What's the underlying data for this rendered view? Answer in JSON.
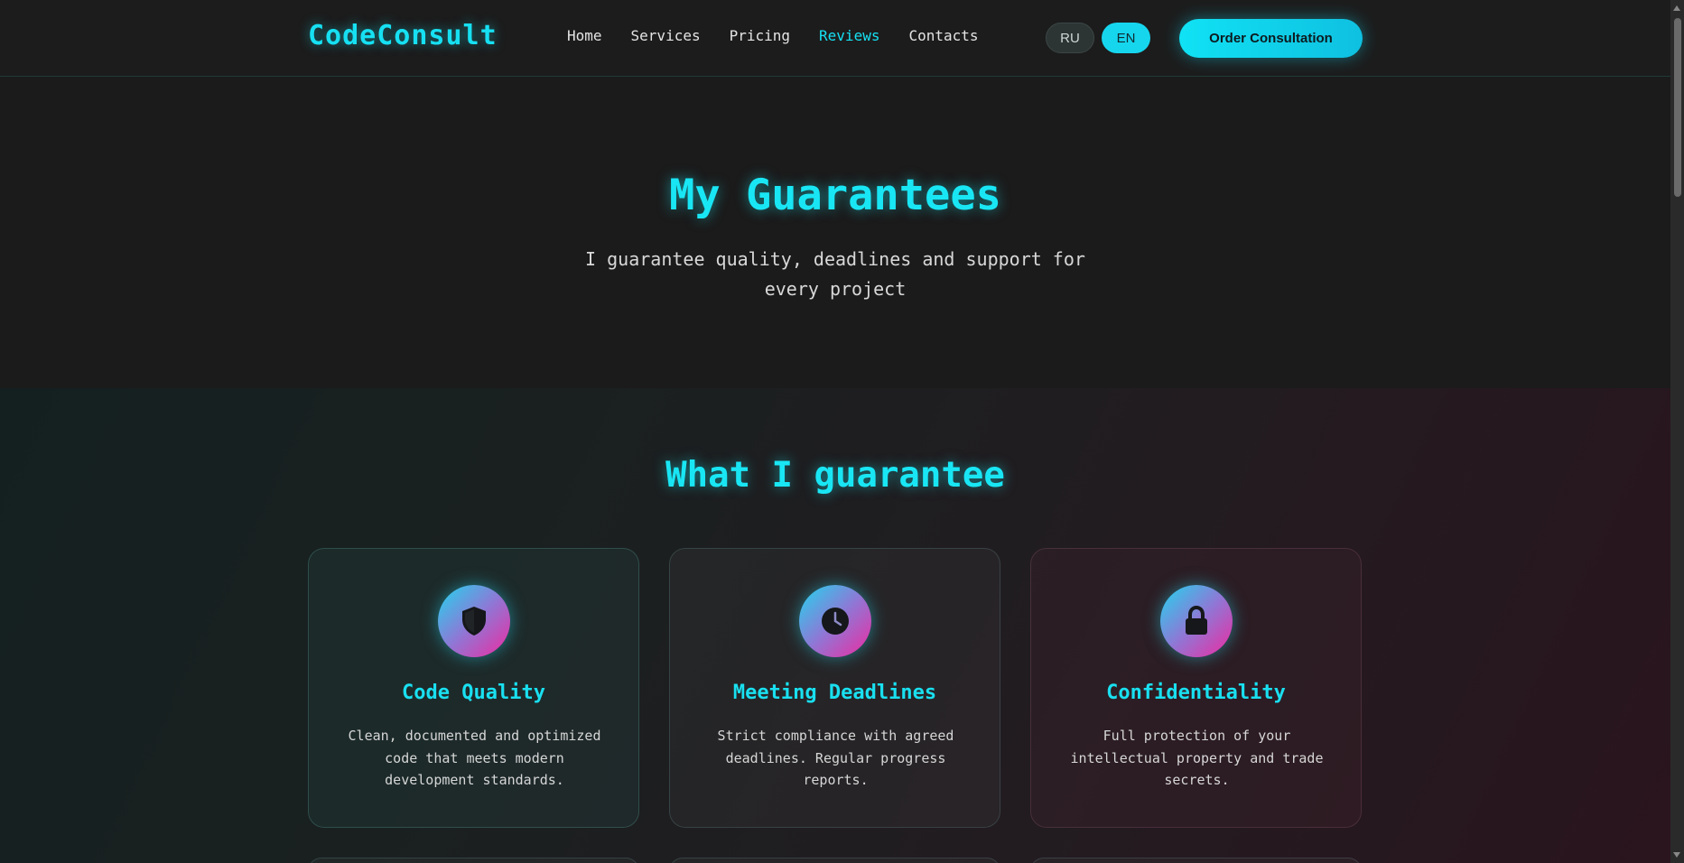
{
  "header": {
    "logo": "CodeConsult",
    "nav": [
      {
        "label": "Home",
        "active": false
      },
      {
        "label": "Services",
        "active": false
      },
      {
        "label": "Pricing",
        "active": false
      },
      {
        "label": "Reviews",
        "active": true
      },
      {
        "label": "Contacts",
        "active": false
      }
    ],
    "languages": [
      {
        "label": "RU",
        "selected": false
      },
      {
        "label": "EN",
        "selected": true
      }
    ],
    "cta_label": "Order Consultation"
  },
  "hero": {
    "title": "My Guarantees",
    "subtitle": "I guarantee quality, deadlines and support for every project"
  },
  "guarantees": {
    "title": "What I guarantee",
    "cards": [
      {
        "icon": "shield-icon",
        "title": "Code Quality",
        "text": "Clean, documented and optimized code that meets modern development standards."
      },
      {
        "icon": "clock-icon",
        "title": "Meeting Deadlines",
        "text": "Strict compliance with agreed deadlines. Regular progress reports."
      },
      {
        "icon": "lock-icon",
        "title": "Confidentiality",
        "text": "Full protection of your intellectual property and trade secrets."
      }
    ]
  },
  "colors": {
    "accent": "#16e0f2",
    "background": "#1a1a1a",
    "icon_gradient_start": "#21d6ee",
    "icon_gradient_end": "#ee2aa0"
  }
}
